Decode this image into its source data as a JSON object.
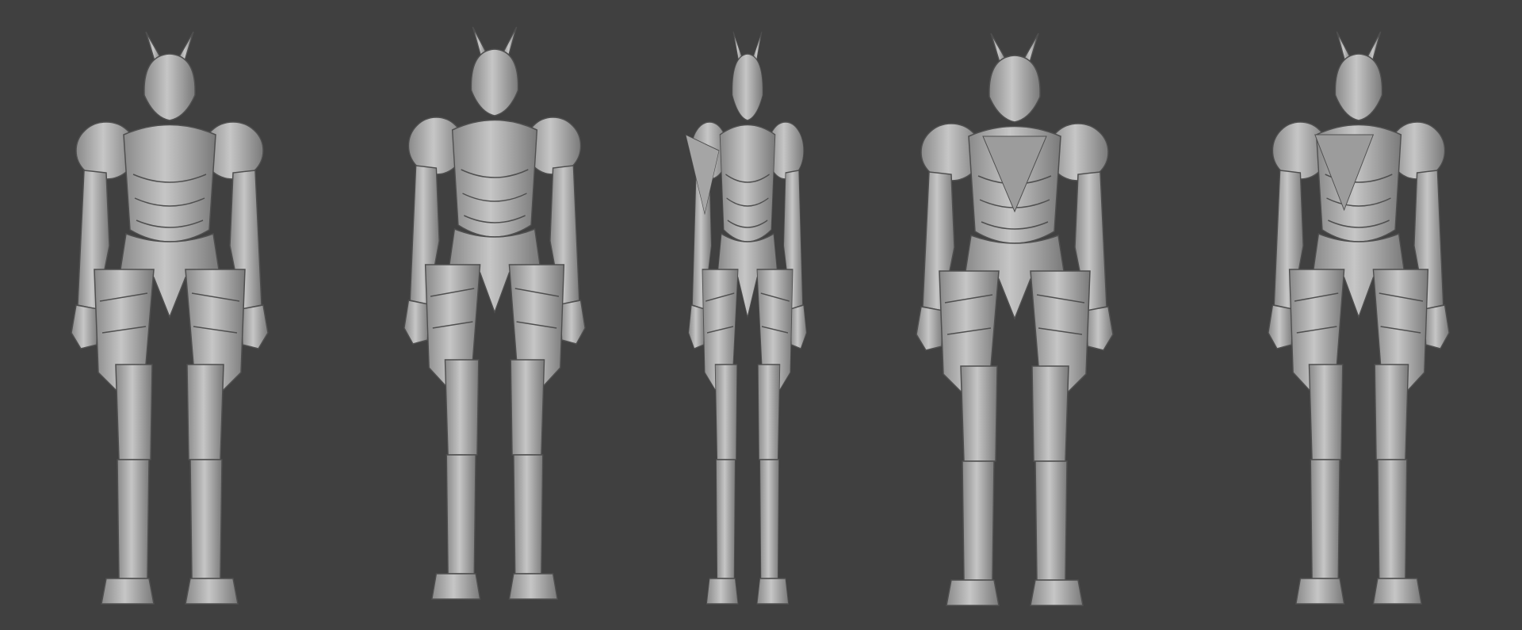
{
  "colors": {
    "background": "#404040",
    "model_light": "#c4c4c4",
    "model_mid": "#9a9a9a",
    "model_dark": "#6e6e6e",
    "seam": "#4a4a4a"
  }
}
